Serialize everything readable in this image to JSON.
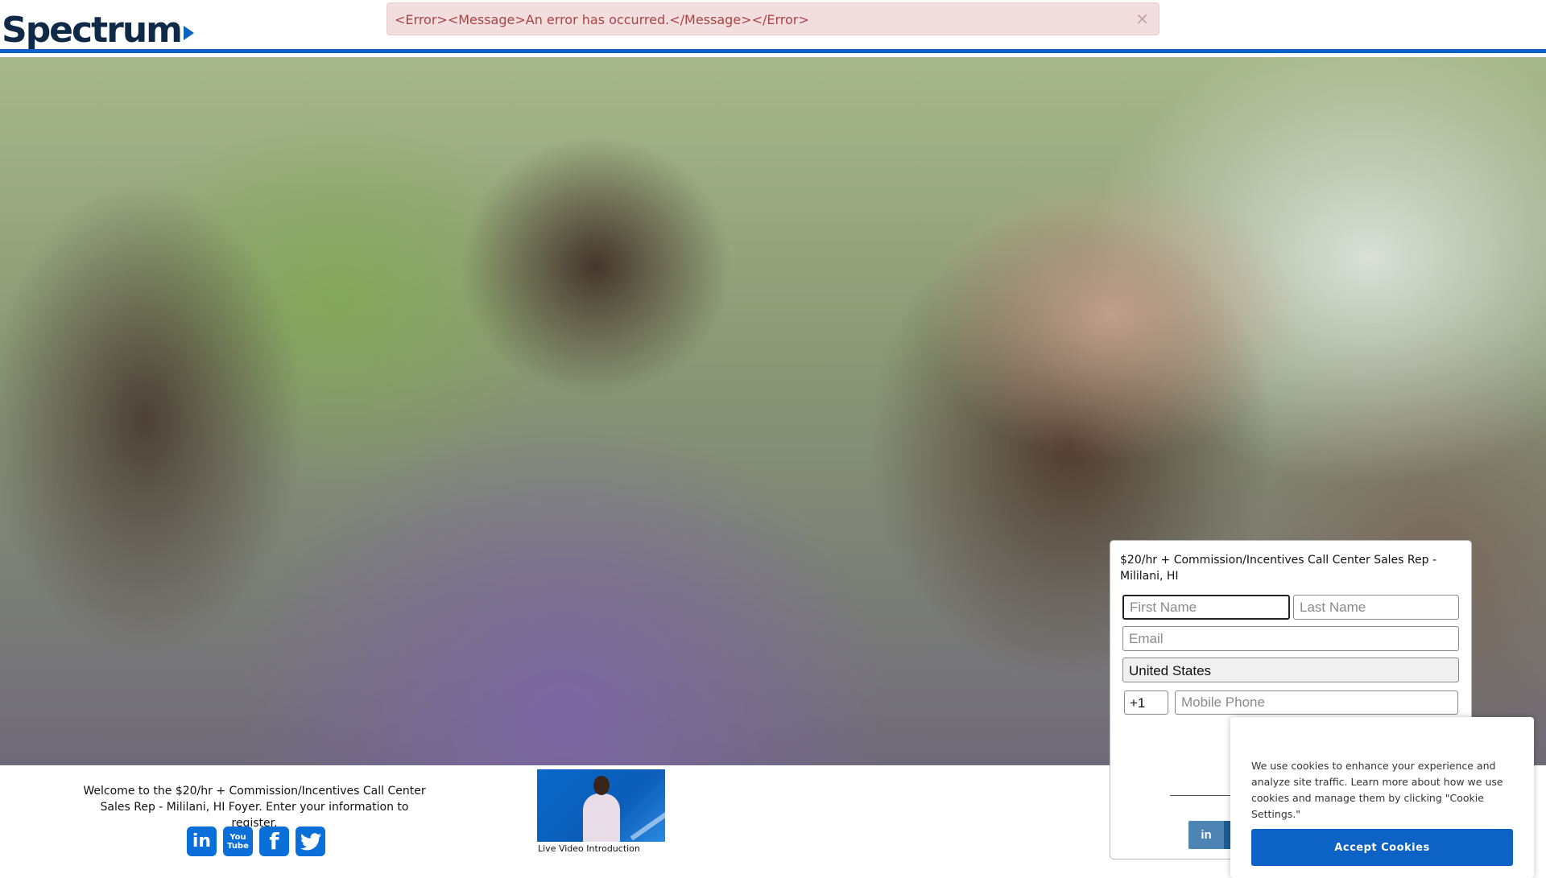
{
  "header": {
    "logo_text": "Spectrum",
    "brand_color": "#0d62c6"
  },
  "alert": {
    "message": "<Error><Message>An error has occurred.</Message></Error>",
    "close_label": "×"
  },
  "form": {
    "title": "$20/hr + Commission/Incentives Call Center Sales Rep - Mililani, HI",
    "first_name_placeholder": "First Name",
    "last_name_placeholder": "Last Name",
    "email_placeholder": "Email",
    "country_value": "United States",
    "country_code": "+1",
    "mobile_placeholder": "Mobile Phone",
    "linkedin_label": "in"
  },
  "welcome": {
    "text": "Welcome to the $20/hr + Commission/Incentives Call Center Sales Rep - Mililani, HI Foyer. Enter your information to register."
  },
  "social": {
    "linkedin_icon": "in",
    "youtube_icon_top": "You",
    "youtube_icon_bottom": "Tube",
    "facebook_icon": "f",
    "twitter_icon": "🐦"
  },
  "video": {
    "caption": "Live Video Introduction"
  },
  "cookie": {
    "text": "We use cookies to enhance your experience and analyze site traffic. Learn more about how we use cookies and manage them by clicking \"Cookie Settings.\"",
    "accept_label": "Accept Cookies"
  }
}
